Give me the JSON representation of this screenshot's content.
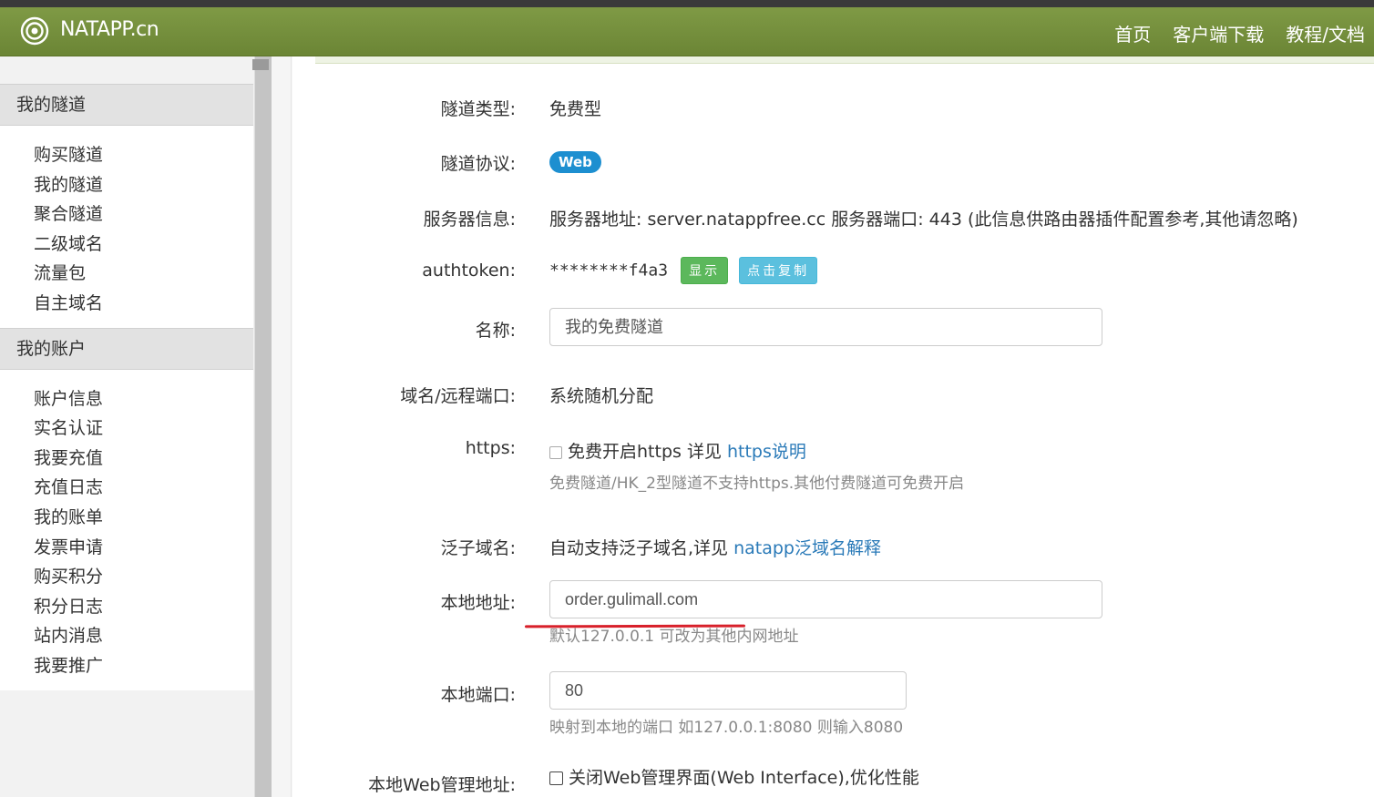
{
  "navbar": {
    "brand": "NATAPP.cn",
    "links": [
      "首页",
      "客户端下载",
      "教程/文档"
    ]
  },
  "sidebar": {
    "sections": [
      {
        "title": "我的隧道",
        "items": [
          "购买隧道",
          "我的隧道",
          "聚合隧道",
          "二级域名",
          "流量包",
          "自主域名"
        ]
      },
      {
        "title": "我的账户",
        "items": [
          "账户信息",
          "实名认证",
          "我要充值",
          "充值日志",
          "我的账单",
          "发票申请",
          "购买积分",
          "积分日志",
          "站内消息",
          "我要推广"
        ]
      }
    ]
  },
  "form": {
    "tunnel_type": {
      "label": "隧道类型:",
      "value": "免费型"
    },
    "protocol": {
      "label": "隧道协议:",
      "badge": "Web"
    },
    "server": {
      "label": "服务器信息:",
      "value": "服务器地址: server.natappfree.cc 服务器端口: 443 (此信息供路由器插件配置参考,其他请忽略)"
    },
    "authtoken": {
      "label": "authtoken:",
      "value": "********f4a3",
      "show_button": "显示",
      "copy_button": "点击复制"
    },
    "name": {
      "label": "名称:",
      "value": "我的免费隧道"
    },
    "domain": {
      "label": "域名/远程端口:",
      "value": "系统随机分配"
    },
    "https": {
      "label": "https:",
      "checkbox_text": "免费开启https 详见 ",
      "link": "https说明",
      "help": "免费隧道/HK_2型隧道不支持https.其他付费隧道可免费开启"
    },
    "wildcard": {
      "label": "泛子域名:",
      "text": "自动支持泛子域名,详见 ",
      "link": "natapp泛域名解释"
    },
    "local_address": {
      "label": "本地地址:",
      "value": "order.gulimall.com",
      "help": "默认127.0.0.1 可改为其他内网地址"
    },
    "local_port": {
      "label": "本地端口:",
      "value": "80",
      "help": "映射到本地的端口 如127.0.0.1:8080 则输入8080"
    },
    "web_admin": {
      "label": "本地Web管理地址:",
      "checkbox_text": "关闭Web管理界面(Web Interface),优化性能"
    }
  }
}
